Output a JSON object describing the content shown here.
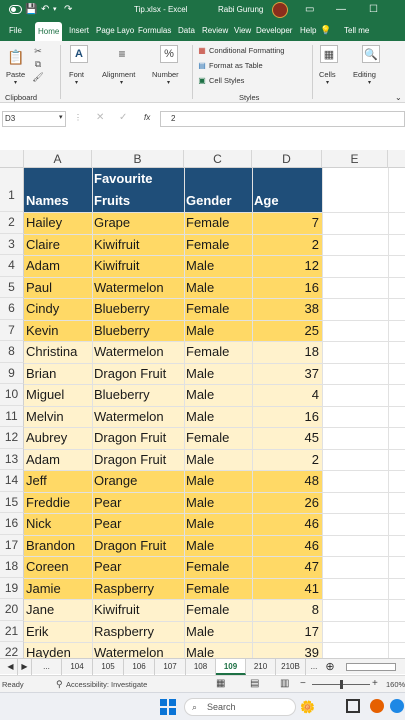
{
  "titlebar": {
    "filename": "Tip.xlsx",
    "app": "Excel",
    "separator": "-",
    "user": "Rabi Gurung"
  },
  "tabs": [
    "File",
    "Home",
    "Insert",
    "Page Layo",
    "Formulas",
    "Data",
    "Review",
    "View",
    "Developer",
    "Help",
    "Tell me"
  ],
  "active_tab": "Home",
  "ribbon": {
    "paste": "Paste",
    "clipboard": "Clipboard",
    "font": "Font",
    "alignment": "Alignment",
    "number": "Number",
    "conditional_formatting": "Conditional Formatting",
    "format_as_table": "Format as Table",
    "cell_styles": "Cell Styles",
    "styles": "Styles",
    "cells": "Cells",
    "editing": "Editing"
  },
  "formula_bar": {
    "name_box": "D3",
    "fx": "fx",
    "value": "2"
  },
  "columns": [
    "A",
    "B",
    "C",
    "D",
    "E"
  ],
  "header_row": {
    "row": "1",
    "a": "Names",
    "b_line1": "Favourite",
    "b_line2": "Fruits",
    "c": "Gender",
    "d": "Age"
  },
  "rows": [
    {
      "row": "2",
      "name": "Hailey",
      "fruit": "Grape",
      "gender": "Female",
      "age": "7",
      "band": "gold"
    },
    {
      "row": "3",
      "name": "Claire",
      "fruit": "Kiwifruit",
      "gender": "Female",
      "age": "2",
      "band": "gold"
    },
    {
      "row": "4",
      "name": "Adam",
      "fruit": "Kiwifruit",
      "gender": "Male",
      "age": "12",
      "band": "gold"
    },
    {
      "row": "5",
      "name": "Paul",
      "fruit": "Watermelon",
      "gender": "Male",
      "age": "16",
      "band": "gold"
    },
    {
      "row": "6",
      "name": "Cindy",
      "fruit": "Blueberry",
      "gender": "Female",
      "age": "38",
      "band": "gold"
    },
    {
      "row": "7",
      "name": "Kevin",
      "fruit": "Blueberry",
      "gender": "Male",
      "age": "25",
      "band": "gold"
    },
    {
      "row": "8",
      "name": "Christina",
      "fruit": "Watermelon",
      "gender": "Female",
      "age": "18",
      "band": "cream"
    },
    {
      "row": "9",
      "name": "Brian",
      "fruit": "Dragon Fruit",
      "gender": "Male",
      "age": "37",
      "band": "cream"
    },
    {
      "row": "10",
      "name": "Miguel",
      "fruit": "Blueberry",
      "gender": "Male",
      "age": "4",
      "band": "cream"
    },
    {
      "row": "11",
      "name": "Melvin",
      "fruit": "Watermelon",
      "gender": "Male",
      "age": "16",
      "band": "cream"
    },
    {
      "row": "12",
      "name": "Aubrey",
      "fruit": "Dragon Fruit",
      "gender": "Female",
      "age": "45",
      "band": "cream"
    },
    {
      "row": "13",
      "name": "Adam",
      "fruit": "Dragon Fruit",
      "gender": "Male",
      "age": "2",
      "band": "cream"
    },
    {
      "row": "14",
      "name": "Jeff",
      "fruit": "Orange",
      "gender": "Male",
      "age": "48",
      "band": "gold"
    },
    {
      "row": "15",
      "name": "Freddie",
      "fruit": "Pear",
      "gender": "Male",
      "age": "26",
      "band": "gold"
    },
    {
      "row": "16",
      "name": "Nick",
      "fruit": "Pear",
      "gender": "Male",
      "age": "46",
      "band": "gold"
    },
    {
      "row": "17",
      "name": "Brandon",
      "fruit": "Dragon Fruit",
      "gender": "Male",
      "age": "46",
      "band": "gold"
    },
    {
      "row": "18",
      "name": "Coreen",
      "fruit": "Pear",
      "gender": "Female",
      "age": "47",
      "band": "gold"
    },
    {
      "row": "19",
      "name": "Jamie",
      "fruit": "Raspberry",
      "gender": "Female",
      "age": "41",
      "band": "gold"
    },
    {
      "row": "20",
      "name": "Jane",
      "fruit": "Kiwifruit",
      "gender": "Female",
      "age": "8",
      "band": "cream"
    },
    {
      "row": "21",
      "name": "Erik",
      "fruit": "Raspberry",
      "gender": "Male",
      "age": "17",
      "band": "cream"
    },
    {
      "row": "22",
      "name": "Hayden",
      "fruit": "Watermelon",
      "gender": "Male",
      "age": "39",
      "band": "cream"
    }
  ],
  "colors": {
    "excel_green": "#1e7145",
    "header_blue": "#1f4e79",
    "band_gold": "#ffd966",
    "band_cream": "#fff2cc"
  },
  "sheet_tabs": [
    "104",
    "105",
    "106",
    "107",
    "108",
    "109",
    "210",
    "210B"
  ],
  "active_sheet": "109",
  "statusbar": {
    "ready": "Ready",
    "accessibility": "Accessibility: Investigate",
    "zoom": "160%"
  },
  "taskbar": {
    "search": "Search"
  },
  "icons": [
    "save-icon",
    "undo-icon",
    "redo-icon",
    "search-icon",
    "paste-icon",
    "windows-start-icon"
  ]
}
